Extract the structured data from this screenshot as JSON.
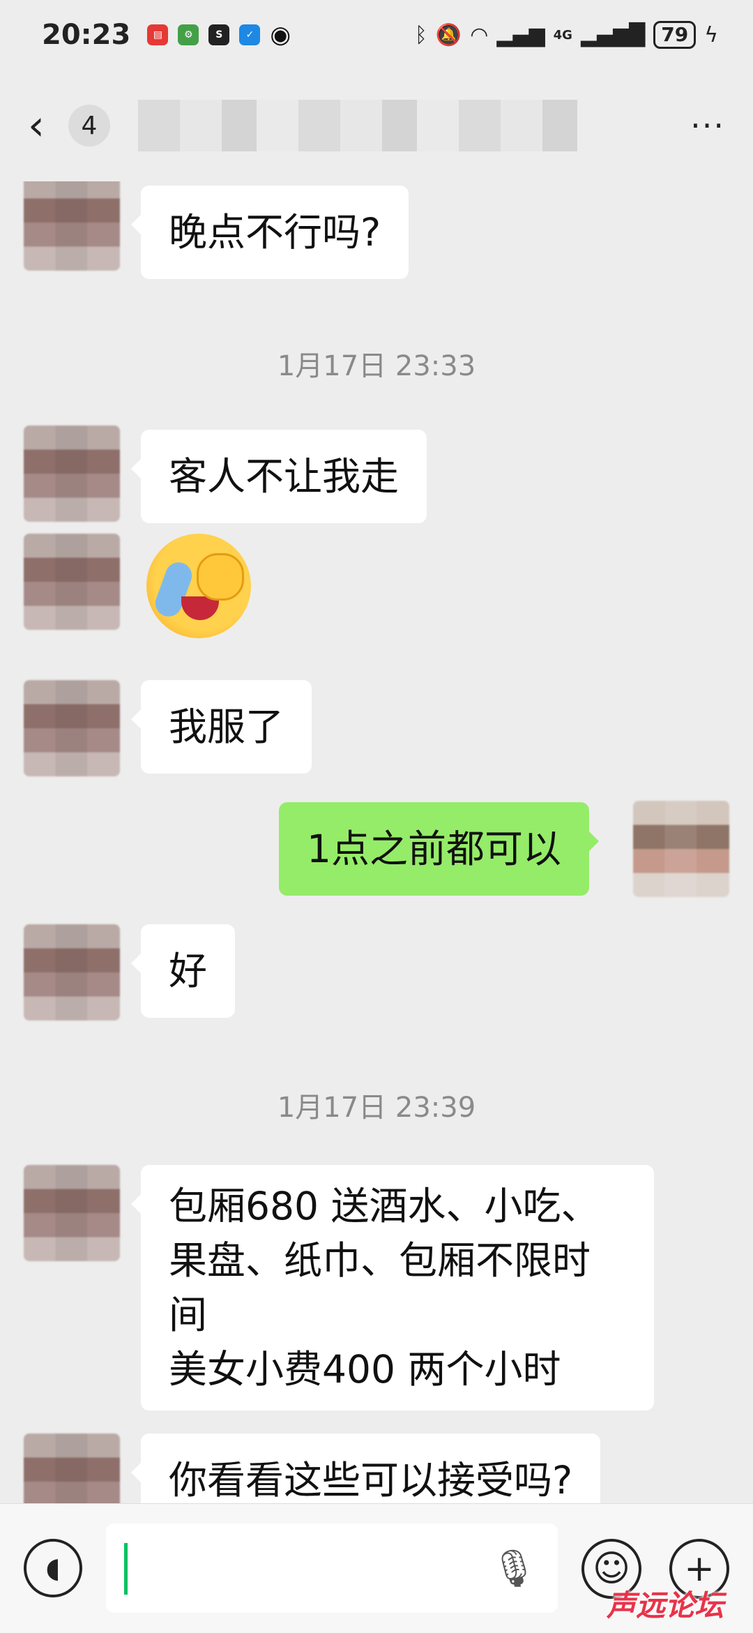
{
  "status_bar": {
    "time": "20:23",
    "battery": "79",
    "network": "4G"
  },
  "nav": {
    "unread_count": "4",
    "more": "···"
  },
  "messages": [
    {
      "text": "晚点不行吗?"
    },
    {
      "time": "1月17日 23:33"
    },
    {
      "text": "客人不让我走"
    },
    {
      "sticker": "crying-face-emoji"
    },
    {
      "text": "我服了"
    },
    {
      "text": "1点之前都可以"
    },
    {
      "text": "好"
    },
    {
      "time": "1月17日 23:39"
    },
    {
      "lines": [
        "包厢680 送酒水、小吃、",
        "果盘、纸巾、包厢不限时",
        "间",
        "美女小费400 两个小时"
      ]
    },
    {
      "text": "你看看这些可以接受吗?"
    }
  ],
  "input_bar": {
    "voice_icon": "voice-toggle-icon",
    "mic_icon": "microphone-icon",
    "emoji_icon": "emoji-icon",
    "plus_icon": "plus-icon"
  },
  "watermark": "声远论坛",
  "colors": {
    "chat_bg": "#ededed",
    "incoming_bubble": "#ffffff",
    "outgoing_bubble": "#95ec69",
    "cursor": "#07c160",
    "watermark": "#e8334a"
  }
}
